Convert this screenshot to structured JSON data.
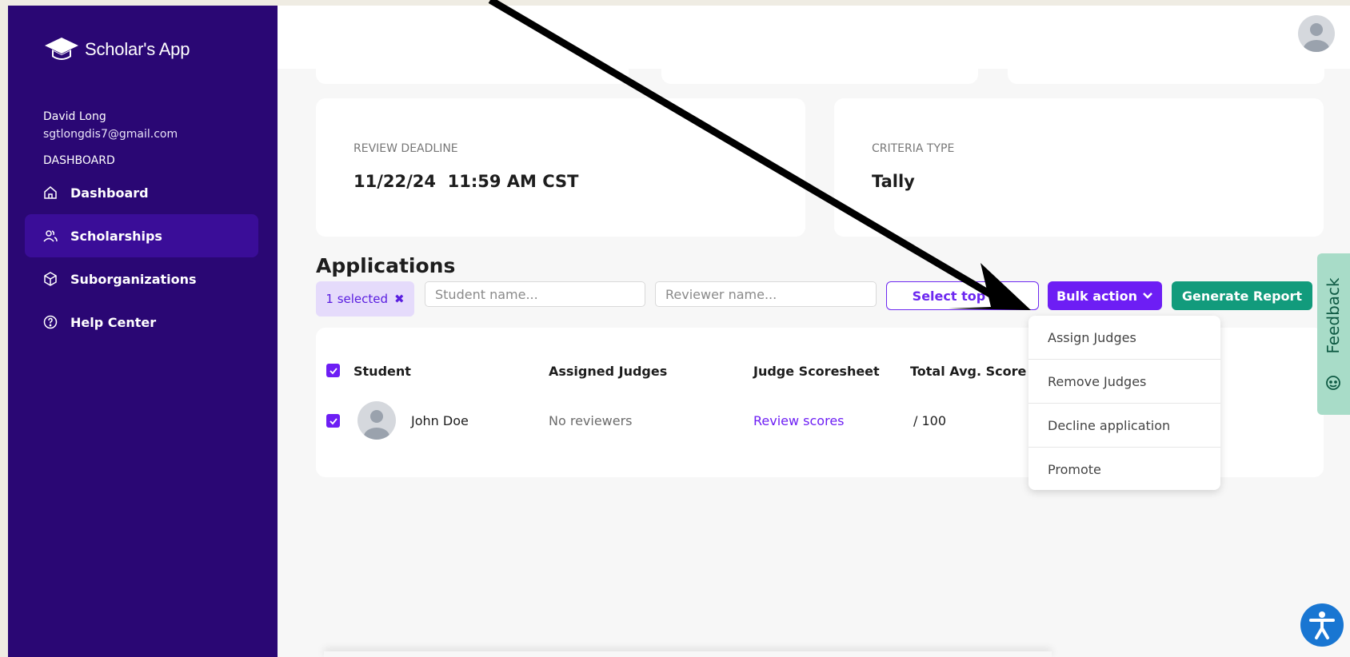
{
  "sidebar": {
    "app_name": "Scholar's App",
    "user_name": "David Long",
    "user_email": "sgtlongdis7@gmail.com",
    "section_label": "DASHBOARD",
    "items": [
      {
        "label": "Dashboard",
        "icon": "home-icon",
        "active": false
      },
      {
        "label": "Scholarships",
        "icon": "users-icon",
        "active": true
      },
      {
        "label": "Suborganizations",
        "icon": "cube-icon",
        "active": false
      },
      {
        "label": "Help Center",
        "icon": "help-circle-icon",
        "active": false
      }
    ]
  },
  "cards": [
    {
      "label": "REVIEW DEADLINE",
      "value": "11/22/24  11:59 AM CST"
    },
    {
      "label": "CRITERIA TYPE",
      "value": "Tally"
    }
  ],
  "applications": {
    "title": "Applications",
    "selected_chip": "1 selected",
    "student_search_placeholder": "Student name...",
    "reviewer_search_placeholder": "Reviewer name...",
    "select_top_button": "Select top stu",
    "bulk_action_button": "Bulk action",
    "generate_report_button": "Generate Report",
    "columns": [
      "Student",
      "Assigned Judges",
      "Judge Scoresheet",
      "Total Avg. Score"
    ],
    "rows": [
      {
        "student": "John Doe",
        "judges": "No reviewers",
        "scoresheet": "Review scores",
        "score": "/ 100",
        "checked": true
      }
    ]
  },
  "bulk_menu": {
    "items": [
      "Assign Judges",
      "Remove Judges",
      "Decline application",
      "Promote"
    ]
  },
  "feedback_tab": "Feedback",
  "colors": {
    "sidebar_bg": "#2a0774",
    "accent": "#6d1ef4",
    "report_green": "#129b7c",
    "feedback_bg": "#a8dcc8"
  }
}
